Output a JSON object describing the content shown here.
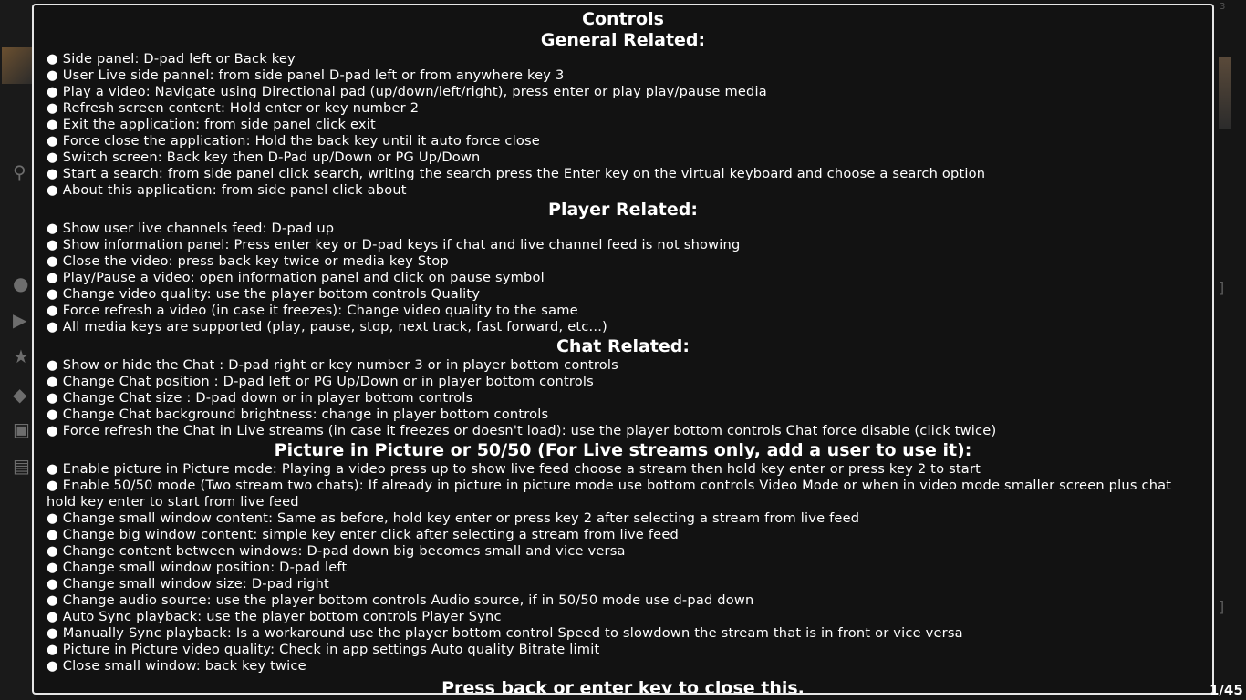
{
  "dialog": {
    "title": "Controls",
    "sections": [
      {
        "heading": "General Related:",
        "items": [
          "Side panel: D-pad left or Back key",
          "User Live side pannel: from side panel D-pad left or from anywhere key 3",
          "Play a video: Navigate using Directional pad (up/down/left/right), press enter or play play/pause media",
          "Refresh screen content: Hold enter or key number 2",
          "Exit the application: from side panel click exit",
          "Force close the application: Hold the back key until it auto force close",
          "Switch screen: Back key then D-Pad up/Down or PG Up/Down",
          "Start a search: from side panel click search, writing the search press the Enter key on the virtual keyboard and choose a search option",
          "About this application: from side panel click about"
        ]
      },
      {
        "heading": "Player Related:",
        "items": [
          "Show user live channels feed: D-pad up",
          "Show information panel: Press enter key or D-pad keys if chat and live channel feed is not showing",
          "Close the video: press back key twice or media key Stop",
          "Play/Pause a video: open information panel and click on pause symbol",
          "Change video quality: use the player bottom controls Quality",
          "Force refresh a video (in case it freezes): Change video quality to the same",
          "All media keys are supported (play, pause, stop, next track, fast forward, etc...)"
        ]
      },
      {
        "heading": "Chat Related:",
        "items": [
          "Show or hide the Chat : D-pad right or key number 3 or in player bottom controls",
          "Change Chat position : D-pad left or PG Up/Down or in player bottom controls",
          "Change Chat size : D-pad down or in player bottom controls",
          "Change Chat background brightness: change in player bottom controls",
          "Force refresh the Chat in Live streams (in case it freezes or doesn't load): use the player bottom controls Chat force disable (click twice)"
        ]
      },
      {
        "heading": "Picture in Picture or 50/50 (For Live streams only, add a user to use it):",
        "items": [
          "Enable picture in Picture mode: Playing a video press up to show live feed choose a stream then hold key enter or press key 2 to start",
          "Enable 50/50 mode (Two stream two chats): If already in picture in picture mode use bottom controls Video Mode or when in video mode smaller screen plus chat hold key enter to start from live feed",
          "Change small window content: Same as before, hold key enter or press key 2 after selecting a stream from live feed",
          "Change big window content: simple key enter click after selecting a stream from live feed",
          "Change content between windows: D-pad down big becomes small and vice versa",
          "Change small window position: D-pad left",
          "Change small window size: D-pad right",
          "Change audio source: use the player bottom controls Audio source, if in 50/50 mode use d-pad down",
          "Auto Sync playback: use the player bottom controls Player Sync",
          "Manually Sync playback: Is a workaround use the player bottom control Speed to slowdown the stream that is in front or vice versa",
          "Picture in Picture video quality: Check in app settings Auto quality Bitrate limit",
          "Close small window: back key twice"
        ]
      }
    ],
    "footer": "Press back or enter key to close this."
  },
  "background": {
    "counter": "1/45",
    "corner_number": "3",
    "side_icons": [
      "search-icon",
      "user-icon",
      "play-icon",
      "star-icon",
      "gamepad-icon",
      "video-icon",
      "film-icon"
    ]
  },
  "colors": {
    "dialog_bg": "#121212",
    "dialog_border": "#e6e6e6",
    "text": "#ffffff"
  },
  "bullet": "●"
}
